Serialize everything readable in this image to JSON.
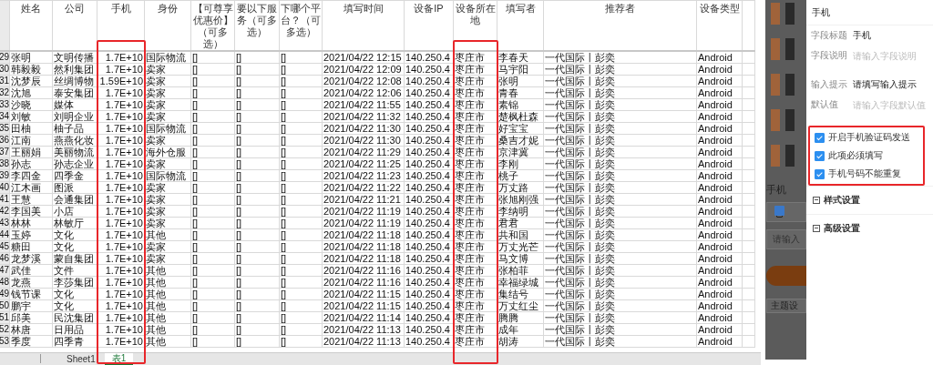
{
  "sheet": {
    "columns": [
      {
        "label": "姓名",
        "highlighted": false
      },
      {
        "label": "公司",
        "highlighted": false
      },
      {
        "label": "手机",
        "highlighted": true
      },
      {
        "label": "身份",
        "highlighted": false
      },
      {
        "label": "【可尊享优惠价】（可多选）",
        "highlighted": false
      },
      {
        "label": "要以下服务（可多选）",
        "highlighted": false
      },
      {
        "label": "下哪个平台？（可多选）",
        "highlighted": false
      },
      {
        "label": "填写时间",
        "highlighted": false
      },
      {
        "label": "设备IP",
        "highlighted": false
      },
      {
        "label": "设备所在地",
        "highlighted": true
      },
      {
        "label": "填写者",
        "highlighted": false
      },
      {
        "label": "推荐者",
        "highlighted": false
      },
      {
        "label": "设备类型",
        "highlighted": false
      }
    ],
    "rows": [
      {
        "row_number": "29",
        "cells": [
          "张明",
          "文明传播",
          "1.7E+10",
          "国际物流",
          "[]",
          "[]",
          "[]",
          "2021/04/22 12:15",
          "140.250.4",
          "枣庄市",
          "李春天",
          "一代国际丨彭奕",
          "Android"
        ]
      },
      {
        "row_number": "30",
        "cells": [
          "韩毅毅",
          "然利集团",
          "1.7E+10",
          "卖家",
          "[]",
          "[]",
          "[]",
          "2021/04/22 12:09",
          "140.250.4",
          "枣庄市",
          "马宇阳",
          "一代国际丨彭奕",
          "Android"
        ]
      },
      {
        "row_number": "31",
        "cells": [
          "沈梦辰",
          "丝绸博物",
          "1.59E+10",
          "卖家",
          "[]",
          "[]",
          "[]",
          "2021/04/22 12:08",
          "140.250.4",
          "枣庄市",
          "张明",
          "一代国际丨彭奕",
          "Android"
        ]
      },
      {
        "row_number": "32",
        "cells": [
          "沈旭",
          "泰安集团",
          "1.7E+10",
          "卖家",
          "[]",
          "[]",
          "[]",
          "2021/04/22 12:06",
          "140.250.4",
          "枣庄市",
          "青春",
          "一代国际丨彭奕",
          "Android"
        ]
      },
      {
        "row_number": "33",
        "cells": [
          "沙晓",
          "媒体",
          "1.7E+10",
          "卖家",
          "[]",
          "[]",
          "[]",
          "2021/04/22 11:55",
          "140.250.4",
          "枣庄市",
          "素锦",
          "一代国际丨彭奕",
          "Android"
        ]
      },
      {
        "row_number": "34",
        "cells": [
          "刘敏",
          "刘明企业",
          "1.7E+10",
          "卖家",
          "[]",
          "[]",
          "[]",
          "2021/04/22 11:32",
          "140.250.4",
          "枣庄市",
          "楚枫杜森",
          "一代国际丨彭奕",
          "Android"
        ]
      },
      {
        "row_number": "35",
        "cells": [
          "田柚",
          "柚子品",
          "1.7E+10",
          "国际物流",
          "[]",
          "[]",
          "[]",
          "2021/04/22 11:30",
          "140.250.4",
          "枣庄市",
          "好宝宝",
          "一代国际丨彭奕",
          "Android"
        ]
      },
      {
        "row_number": "36",
        "cells": [
          "江南",
          "燕燕化妆",
          "1.7E+10",
          "卖家",
          "[]",
          "[]",
          "[]",
          "2021/04/22 11:30",
          "140.250.4",
          "枣庄市",
          "桑吉才妮",
          "一代国际丨彭奕",
          "Android"
        ]
      },
      {
        "row_number": "37",
        "cells": [
          "王丽娟",
          "美丽物流",
          "1.7E+10",
          "海外仓服",
          "[]",
          "[]",
          "[]",
          "2021/04/22 11:29",
          "140.250.4",
          "枣庄市",
          "京津冀",
          "一代国际丨彭奕",
          "Android"
        ]
      },
      {
        "row_number": "38",
        "cells": [
          "孙志",
          "孙志企业",
          "1.7E+10",
          "卖家",
          "[]",
          "[]",
          "[]",
          "2021/04/22 11:25",
          "140.250.4",
          "枣庄市",
          "李刚",
          "一代国际丨彭奕",
          "Android"
        ]
      },
      {
        "row_number": "39",
        "cells": [
          "李四金",
          "四季金",
          "1.7E+10",
          "国际物流",
          "[]",
          "[]",
          "[]",
          "2021/04/22 11:23",
          "140.250.4",
          "枣庄市",
          "桃子",
          "一代国际丨彭奕",
          "Android"
        ]
      },
      {
        "row_number": "40",
        "cells": [
          "江木画",
          "图派",
          "1.7E+10",
          "卖家",
          "[]",
          "[]",
          "[]",
          "2021/04/22 11:22",
          "140.250.4",
          "枣庄市",
          "万丈路",
          "一代国际丨彭奕",
          "Android"
        ]
      },
      {
        "row_number": "41",
        "cells": [
          "王慧",
          "会通集团",
          "1.7E+10",
          "卖家",
          "[]",
          "[]",
          "[]",
          "2021/04/22 11:21",
          "140.250.4",
          "枣庄市",
          "张旭刚强",
          "一代国际丨彭奕",
          "Android"
        ]
      },
      {
        "row_number": "42",
        "cells": [
          "李国美",
          "小店",
          "1.7E+10",
          "卖家",
          "[]",
          "[]",
          "[]",
          "2021/04/22 11:19",
          "140.250.4",
          "枣庄市",
          "李纳明",
          "一代国际丨彭奕",
          "Android"
        ]
      },
      {
        "row_number": "43",
        "cells": [
          "林林",
          "林敏厅",
          "1.7E+10",
          "卖家",
          "[]",
          "[]",
          "[]",
          "2021/04/22 11:19",
          "140.250.4",
          "枣庄市",
          "君君",
          "一代国际丨彭奕",
          "Android"
        ]
      },
      {
        "row_number": "44",
        "cells": [
          "玉婷",
          "文化",
          "1.7E+10",
          "其他",
          "[]",
          "[]",
          "[]",
          "2021/04/22 11:18",
          "140.250.4",
          "枣庄市",
          "共和国",
          "一代国际丨彭奕",
          "Android"
        ]
      },
      {
        "row_number": "45",
        "cells": [
          "糖田",
          "文化",
          "1.7E+10",
          "卖家",
          "[]",
          "[]",
          "[]",
          "2021/04/22 11:18",
          "140.250.4",
          "枣庄市",
          "万丈光芒",
          "一代国际丨彭奕",
          "Android"
        ]
      },
      {
        "row_number": "46",
        "cells": [
          "龙梦溪",
          "蒙自集团",
          "1.7E+10",
          "卖家",
          "[]",
          "[]",
          "[]",
          "2021/04/22 11:18",
          "140.250.4",
          "枣庄市",
          "马文博",
          "一代国际丨彭奕",
          "Android"
        ]
      },
      {
        "row_number": "47",
        "cells": [
          "武佳",
          "文件",
          "1.7E+10",
          "其他",
          "[]",
          "[]",
          "[]",
          "2021/04/22 11:16",
          "140.250.4",
          "枣庄市",
          "张柏菲",
          "一代国际丨彭奕",
          "Android"
        ]
      },
      {
        "row_number": "48",
        "cells": [
          "龙燕",
          "李莎集团",
          "1.7E+10",
          "其他",
          "[]",
          "[]",
          "[]",
          "2021/04/22 11:16",
          "140.250.4",
          "枣庄市",
          "幸福绿城",
          "一代国际丨彭奕",
          "Android"
        ]
      },
      {
        "row_number": "49",
        "cells": [
          "钱节课",
          "文化",
          "1.7E+10",
          "其他",
          "[]",
          "[]",
          "[]",
          "2021/04/22 11:15",
          "140.250.4",
          "枣庄市",
          "集结号",
          "一代国际丨彭奕",
          "Android"
        ]
      },
      {
        "row_number": "50",
        "cells": [
          "鹏宇",
          "文化",
          "1.7E+10",
          "其他",
          "[]",
          "[]",
          "[]",
          "2021/04/22 11:15",
          "140.250.4",
          "枣庄市",
          "万丈红尘",
          "一代国际丨彭奕",
          "Android"
        ]
      },
      {
        "row_number": "51",
        "cells": [
          "邱美",
          "民沈集团",
          "1.7E+10",
          "其他",
          "[]",
          "[]",
          "[]",
          "2021/04/22 11:14",
          "140.250.4",
          "枣庄市",
          "腾腾",
          "一代国际丨彭奕",
          "Android"
        ]
      },
      {
        "row_number": "52",
        "cells": [
          "林唐",
          "日用品",
          "1.7E+10",
          "其他",
          "[]",
          "[]",
          "[]",
          "2021/04/22 11:13",
          "140.250.4",
          "枣庄市",
          "成年",
          "一代国际丨彭奕",
          "Android"
        ]
      },
      {
        "row_number": "53",
        "cells": [
          "季度",
          "四季青",
          "1.7E+10",
          "其他",
          "[]",
          "[]",
          "[]",
          "2021/04/22 11:13",
          "140.250.4",
          "枣庄市",
          "胡涛",
          "一代国际丨彭奕",
          "Android"
        ]
      }
    ],
    "sheet_tabs": [
      {
        "label": "Sheet1",
        "selected": false
      },
      {
        "label": "表1",
        "selected": true
      }
    ]
  },
  "preview": {
    "field_label": "手机",
    "input_placeholder": "请输入",
    "theme_button": "主题设"
  },
  "settings_panel": {
    "title": "手机",
    "fields": [
      {
        "label": "字段标题",
        "value": "手机"
      },
      {
        "label": "字段说明",
        "placeholder": "请输入字段说明"
      },
      {
        "label": "输入提示",
        "value": "请填写输入提示"
      },
      {
        "label": "默认值",
        "placeholder": "请输入字段默认值"
      }
    ],
    "options_highlighted": true,
    "options": [
      {
        "label": "开启手机验证码发送",
        "checked": true
      },
      {
        "label": "此项必须填写",
        "checked": true
      },
      {
        "label": "手机号码不能重复",
        "checked": true
      }
    ],
    "sections": [
      {
        "label": "样式设置",
        "expanded": false
      },
      {
        "label": "高级设置",
        "expanded": false
      }
    ]
  }
}
